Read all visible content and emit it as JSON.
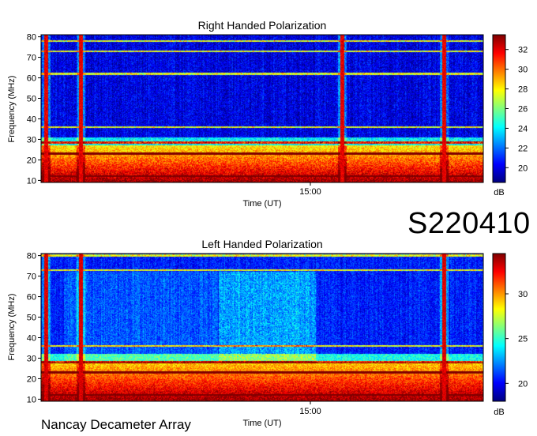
{
  "observation_id": "S220410",
  "footer": "Nancay Decameter Array",
  "chart_data": [
    {
      "type": "heatmap",
      "title": "Right Handed Polarization",
      "xlabel": "Time (UT)",
      "ylabel": "Frequency (MHz)",
      "x_tick_labels": [
        "15:00"
      ],
      "y_ticks": [
        10,
        20,
        30,
        40,
        50,
        60,
        70,
        80
      ],
      "ylim": [
        9,
        81
      ],
      "colorbar": {
        "label": "dB",
        "ticks": [
          20,
          22,
          24,
          26,
          28,
          30,
          32
        ],
        "range": [
          18.5,
          33.5
        ]
      },
      "colormap": "jet",
      "features": {
        "strong_band_mhz": [
          10,
          27
        ],
        "bright_line_mhz": [
          12,
          23,
          28.5,
          36,
          62,
          73,
          78
        ],
        "vertical_stripe_positions": [
          0.01,
          0.09,
          0.68,
          0.91
        ],
        "background_db": 20,
        "low_band_db": 32
      }
    },
    {
      "type": "heatmap",
      "title": "Left Handed Polarization",
      "xlabel": "Time (UT)",
      "ylabel": "Frequency (MHz)",
      "x_tick_labels": [
        "15:00"
      ],
      "y_ticks": [
        10,
        20,
        30,
        40,
        50,
        60,
        70,
        80
      ],
      "ylim": [
        9,
        81
      ],
      "colorbar": {
        "label": "dB",
        "ticks": [
          20,
          25,
          30
        ],
        "range": [
          18,
          34.5
        ]
      },
      "colormap": "jet",
      "features": {
        "strong_band_mhz": [
          10,
          28
        ],
        "bright_line_mhz": [
          12,
          23,
          28,
          36,
          73,
          80
        ],
        "vertical_stripe_positions": [
          0.01,
          0.09,
          0.91
        ],
        "active_burst_span": [
          0.4,
          0.62
        ],
        "background_db": 20.5,
        "low_band_db": 33
      }
    }
  ]
}
